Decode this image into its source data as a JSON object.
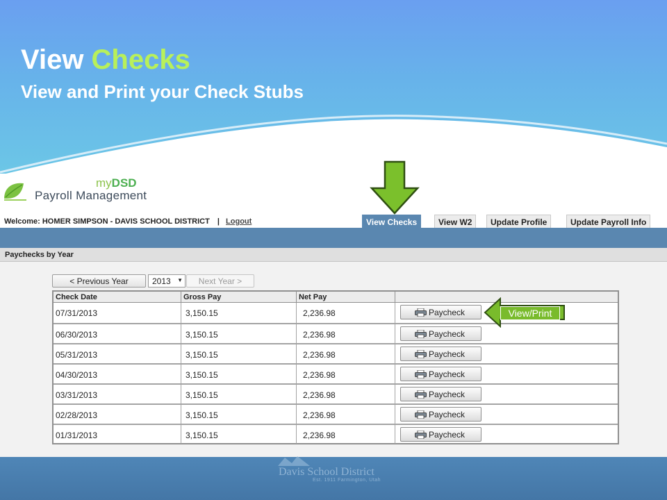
{
  "slide": {
    "title_part1": "View ",
    "title_part2": "Checks",
    "subtitle": "View and Print your Check Stubs"
  },
  "app": {
    "brand_prefix": "my",
    "brand_name": "DSD",
    "product_name": "Payroll Management",
    "welcome_label": "Welcome:",
    "user_name": "HOMER SIMPSON - DAVIS SCHOOL DISTRICT",
    "separator": "|",
    "logout_label": "Logout"
  },
  "tabs": [
    {
      "label": "View Checks",
      "active": true
    },
    {
      "label": "View W2",
      "active": false
    },
    {
      "label": "Update Profile",
      "active": false
    },
    {
      "label": "Update Payroll Info",
      "active": false
    }
  ],
  "panel_title": "Paychecks by Year",
  "year_nav": {
    "previous_label": "< Previous Year",
    "selected_year": "2013",
    "next_label": "Next Year >"
  },
  "table": {
    "columns": [
      "Check Date",
      "Gross Pay",
      "Net Pay",
      ""
    ],
    "button_label": "Paycheck",
    "rows": [
      {
        "date": "07/31/2013",
        "gross": "3,150.15",
        "net": "2,236.98"
      },
      {
        "date": "06/30/2013",
        "gross": "3,150.15",
        "net": "2,236.98"
      },
      {
        "date": "05/31/2013",
        "gross": "3,150.15",
        "net": "2,236.98"
      },
      {
        "date": "04/30/2013",
        "gross": "3,150.15",
        "net": "2,236.98"
      },
      {
        "date": "03/31/2013",
        "gross": "3,150.15",
        "net": "2,236.98"
      },
      {
        "date": "02/28/2013",
        "gross": "3,150.15",
        "net": "2,236.98"
      },
      {
        "date": "01/31/2013",
        "gross": "3,150.15",
        "net": "2,236.98"
      }
    ]
  },
  "callout_label": "View/Print",
  "footer": {
    "name": "Davis School District",
    "est": "Est. 1911 Farmington, Utah"
  },
  "icons": {
    "logo": "leaf-logo-icon",
    "arrow": "down-arrow-icon",
    "printer": "printer-icon",
    "callout": "left-arrow-callout-icon"
  },
  "colors": {
    "header_blue": "#6a9ff0",
    "accent_green": "#b8f05a",
    "arrow_green": "#79bb2c",
    "nav_blue": "#5a87b0",
    "footer_blue": "#4f86b7"
  }
}
